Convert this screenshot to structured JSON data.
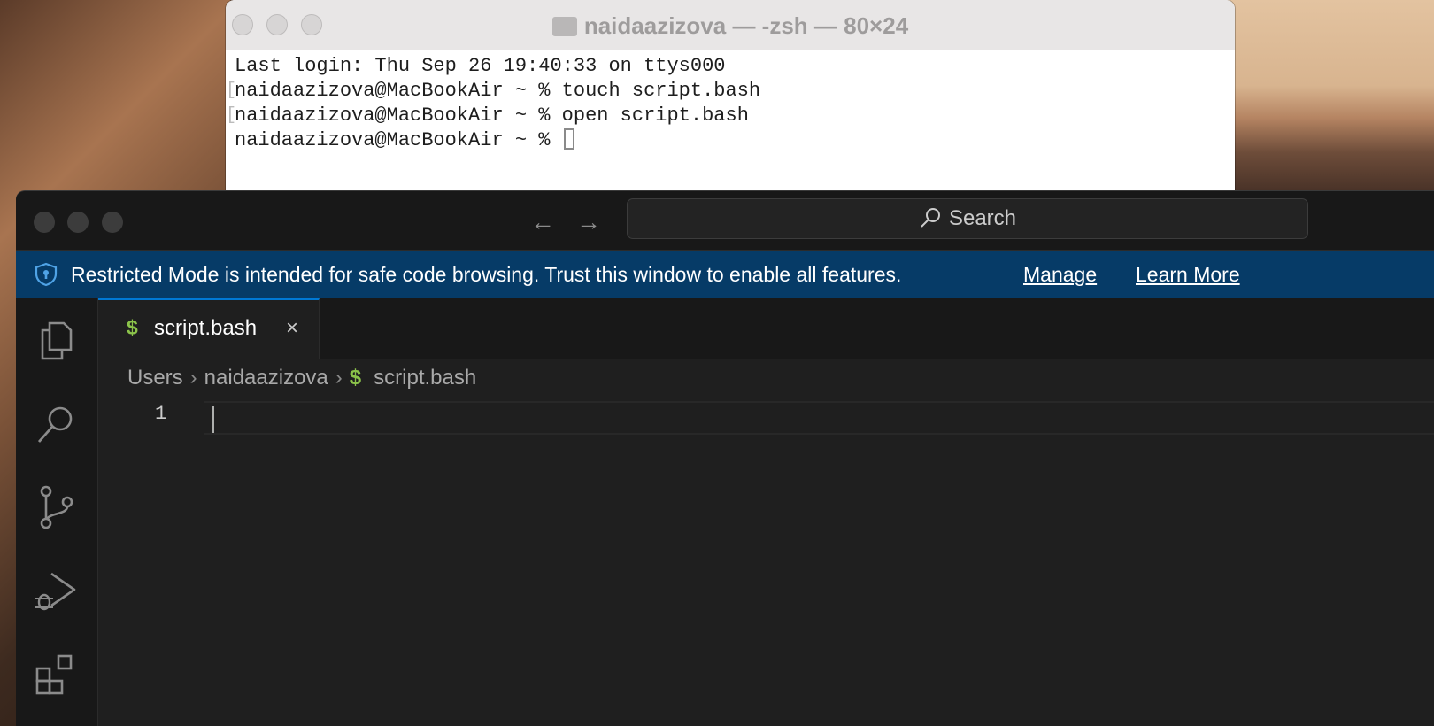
{
  "terminal": {
    "title": "naidaazizova — -zsh — 80×24",
    "lines": [
      "Last login: Thu Sep 26 19:40:33 on ttys000",
      "naidaazizova@MacBookAir ~ % touch script.bash",
      "naidaazizova@MacBookAir ~ % open script.bash",
      "naidaazizova@MacBookAir ~ % "
    ]
  },
  "vscode": {
    "search_label": "Search",
    "banner": {
      "message": "Restricted Mode is intended for safe code browsing. Trust this window to enable all features.",
      "manage": "Manage",
      "learn_more": "Learn More"
    },
    "tab": {
      "icon": "$",
      "label": "script.bash",
      "close": "×"
    },
    "breadcrumb": [
      "Users",
      "naidaazizova",
      "script.bash"
    ],
    "breadcrumb_file_icon": "$",
    "line_number": "1",
    "activity_icons": [
      "files-icon",
      "search-icon",
      "source-control-icon",
      "run-debug-icon",
      "extensions-icon"
    ],
    "colors": {
      "banner": "#063b67",
      "accent": "#0078d4",
      "bash_icon": "#8bc34a"
    }
  }
}
